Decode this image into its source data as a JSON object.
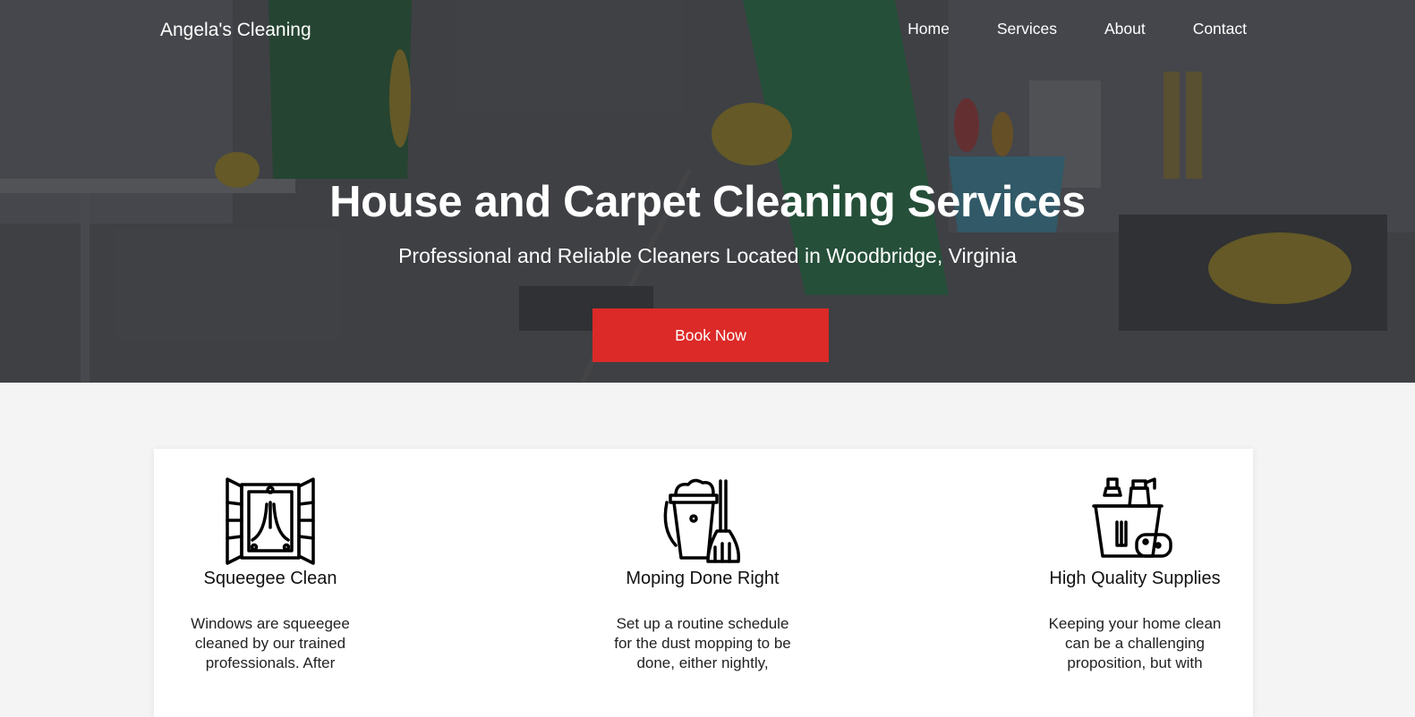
{
  "header": {
    "brand": "Angela's Cleaning",
    "nav": [
      "Home",
      "Services",
      "About",
      "Contact"
    ]
  },
  "hero": {
    "title": "House and Carpet Cleaning Services",
    "subtitle": "Professional and Reliable Cleaners Located in Woodbridge, Virginia",
    "button_label": "Book Now"
  },
  "features": [
    {
      "icon": "window-squeegee-icon",
      "title": "Squeegee Clean",
      "description": "Windows are squeegee cleaned by our trained professionals. After"
    },
    {
      "icon": "bucket-mop-icon",
      "title": "Moping Done Right",
      "description": "Set up a routine schedule for the dust mopping to be done, either nightly,"
    },
    {
      "icon": "cleaning-supplies-icon",
      "title": "High Quality Supplies",
      "description": "Keeping your home clean can be a challenging proposition, but with"
    }
  ],
  "colors": {
    "accent": "#dc2a28",
    "hero_overlay": "#3f4246",
    "page_bg": "#f4f4f4",
    "card_bg": "#ffffff"
  }
}
